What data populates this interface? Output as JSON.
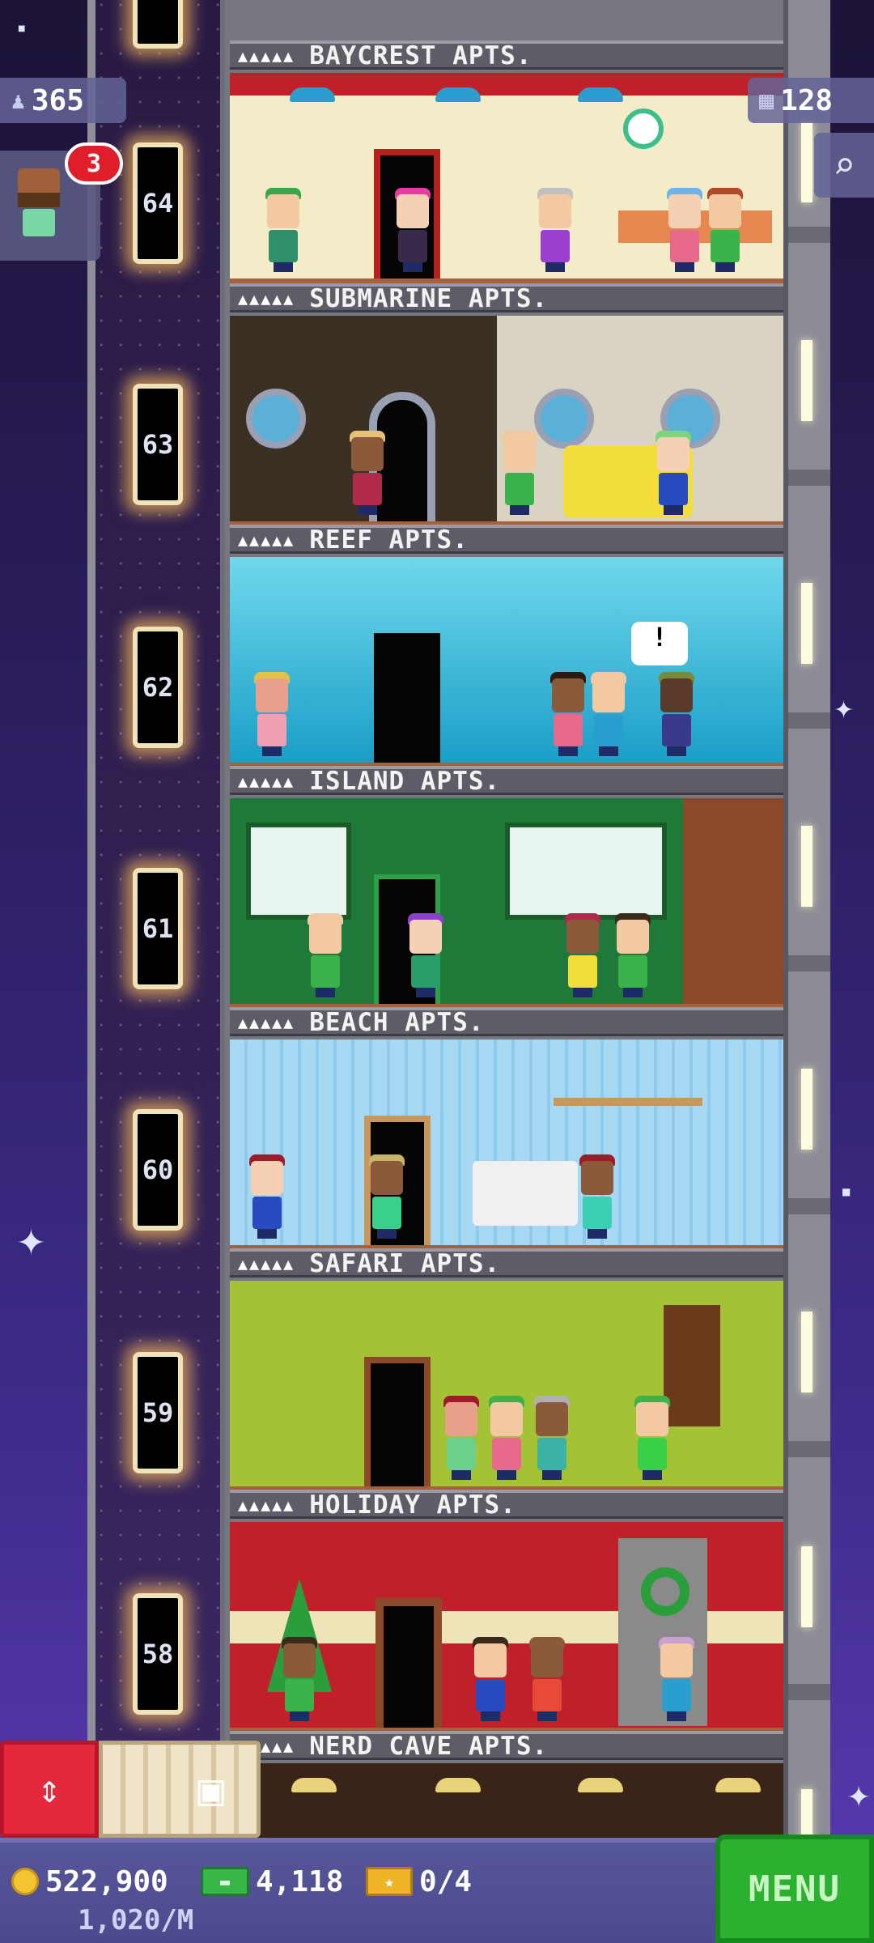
{
  "hud": {
    "population": "365",
    "floor_count": "128",
    "visitor_badge": "3",
    "coins": "522,900",
    "bux": "4,118",
    "tickets": "0/4",
    "income_rate": "1,020/M",
    "menu_label": "MENU"
  },
  "icons": {
    "population": "person-icon",
    "floors": "building-icon",
    "search": "magnifier-icon",
    "elevator": "up-down-arrows-icon",
    "build": "box-icon",
    "coins": "coin-icon",
    "bux": "bux-banknote-icon",
    "tickets": "vip-ticket-icon"
  },
  "colors": {
    "menu_green": "#2bb02f",
    "elevator_red": "#e5283c",
    "badge_red": "#e01e2b",
    "bottom_bar": "#4a4a8c"
  },
  "floors": [
    {
      "number": "64",
      "name": "BAYCREST APTS.",
      "stars": "▲▲▲▲▲"
    },
    {
      "number": "63",
      "name": "SUBMARINE APTS.",
      "stars": "▲▲▲▲▲"
    },
    {
      "number": "62",
      "name": "REEF APTS.",
      "stars": "▲▲▲▲▲"
    },
    {
      "number": "61",
      "name": "ISLAND APTS.",
      "stars": "▲▲▲▲▲"
    },
    {
      "number": "60",
      "name": "BEACH APTS.",
      "stars": "▲▲▲▲▲"
    },
    {
      "number": "59",
      "name": "SAFARI APTS.",
      "stars": "▲▲▲▲▲"
    },
    {
      "number": "58",
      "name": "HOLIDAY APTS.",
      "stars": "▲▲▲▲▲"
    },
    {
      "number": "",
      "name": "NERD CAVE APTS.",
      "stars": "▲▲▲▲▲"
    }
  ]
}
